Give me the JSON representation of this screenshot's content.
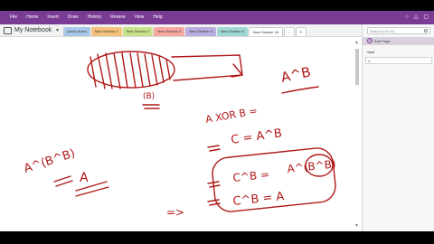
{
  "menu": [
    "File",
    "Home",
    "Insert",
    "Draw",
    "History",
    "Review",
    "View",
    "Help"
  ],
  "notebook": {
    "title": "My Notebook"
  },
  "tabs": [
    {
      "label": "Quick Notes",
      "color": "#a8c8e8"
    },
    {
      "label": "New Section 1",
      "color": "#f4c27a"
    },
    {
      "label": "New Section 2",
      "color": "#c7e28a"
    },
    {
      "label": "New Section 3",
      "color": "#f7a8a0"
    },
    {
      "label": "New Section 4",
      "color": "#b9aee0"
    },
    {
      "label": "New Section 5",
      "color": "#9ed7d4"
    },
    {
      "label": "New Section 18",
      "color": "#ffffff"
    }
  ],
  "tab_more": "...",
  "tab_add": "+",
  "search": {
    "placeholder": "Search (Ctrl+E)"
  },
  "side": {
    "add_page_label": "Add Page",
    "pages": [
      "xlasf",
      "1"
    ]
  },
  "colors": {
    "ribbon": "#7a3b94",
    "ink": "#b01818"
  },
  "handwriting": {
    "top_right": "A^B",
    "axor_label": "A XOR B =",
    "axor_result": "A^B",
    "left_expr": "A^(B^B)",
    "left_result": "A",
    "c_line1": "C = A^B",
    "c_line2_lhs": "C^B =",
    "c_line2_rhs": "A^(B^B)",
    "c_line3": "C^B = A",
    "bottom_mark": "=>",
    "below_oval": "(B)"
  }
}
